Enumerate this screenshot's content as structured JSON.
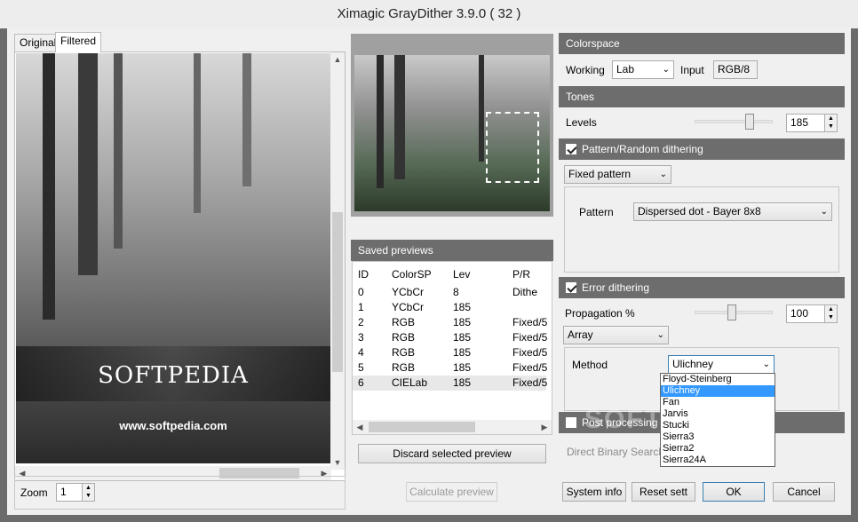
{
  "window": {
    "title": "Ximagic GrayDither 3.9.0 ( 32 )"
  },
  "tabs": [
    {
      "label": "Original"
    },
    {
      "label": "Filtered"
    }
  ],
  "image": {
    "brand": "SOFTPEDIA",
    "url": "www.softpedia.com"
  },
  "zoom": {
    "label": "Zoom",
    "value": "1"
  },
  "calc_button": "Calculate preview",
  "saved_previews": {
    "title": "Saved previews",
    "columns": [
      "ID",
      "ColorSP",
      "Lev",
      "P/R Dithe"
    ],
    "rows": [
      [
        "0",
        "YCbCr",
        "8",
        ""
      ],
      [
        "1",
        "YCbCr",
        "185",
        ""
      ],
      [
        "2",
        "RGB",
        "185",
        "Fixed/5"
      ],
      [
        "3",
        "RGB",
        "185",
        "Fixed/5"
      ],
      [
        "4",
        "RGB",
        "185",
        "Fixed/5"
      ],
      [
        "5",
        "RGB",
        "185",
        "Fixed/5"
      ],
      [
        "6",
        "CIELab",
        "185",
        "Fixed/5"
      ]
    ],
    "discard_button": "Discard selected preview"
  },
  "colorspace": {
    "header": "Colorspace",
    "working_label": "Working",
    "working_value": "Lab",
    "input_label": "Input",
    "input_value": "RGB/8"
  },
  "tones": {
    "header": "Tones",
    "levels_label": "Levels",
    "levels_value": "185"
  },
  "pattern": {
    "header": "Pattern/Random dithering",
    "mode": "Fixed pattern",
    "pattern_label": "Pattern",
    "pattern_value": "Dispersed dot - Bayer 8x8"
  },
  "error": {
    "header": "Error dithering",
    "propagation_label": "Propagation %",
    "propagation_value": "100",
    "mode": "Array",
    "method_label": "Method",
    "method_value": "Ulichney",
    "options": [
      "Floyd-Steinberg",
      "Ulichney",
      "Fan",
      "Jarvis",
      "Stucki",
      "Sierra3",
      "Sierra2",
      "Sierra24A"
    ]
  },
  "post": {
    "header": "Post processing",
    "dbs_label": "Direct Binary Search (D"
  },
  "buttons": {
    "system_info": "System info",
    "reset": "Reset sett",
    "ok": "OK",
    "cancel": "Cancel"
  },
  "watermark": "SOFTPEDIA"
}
